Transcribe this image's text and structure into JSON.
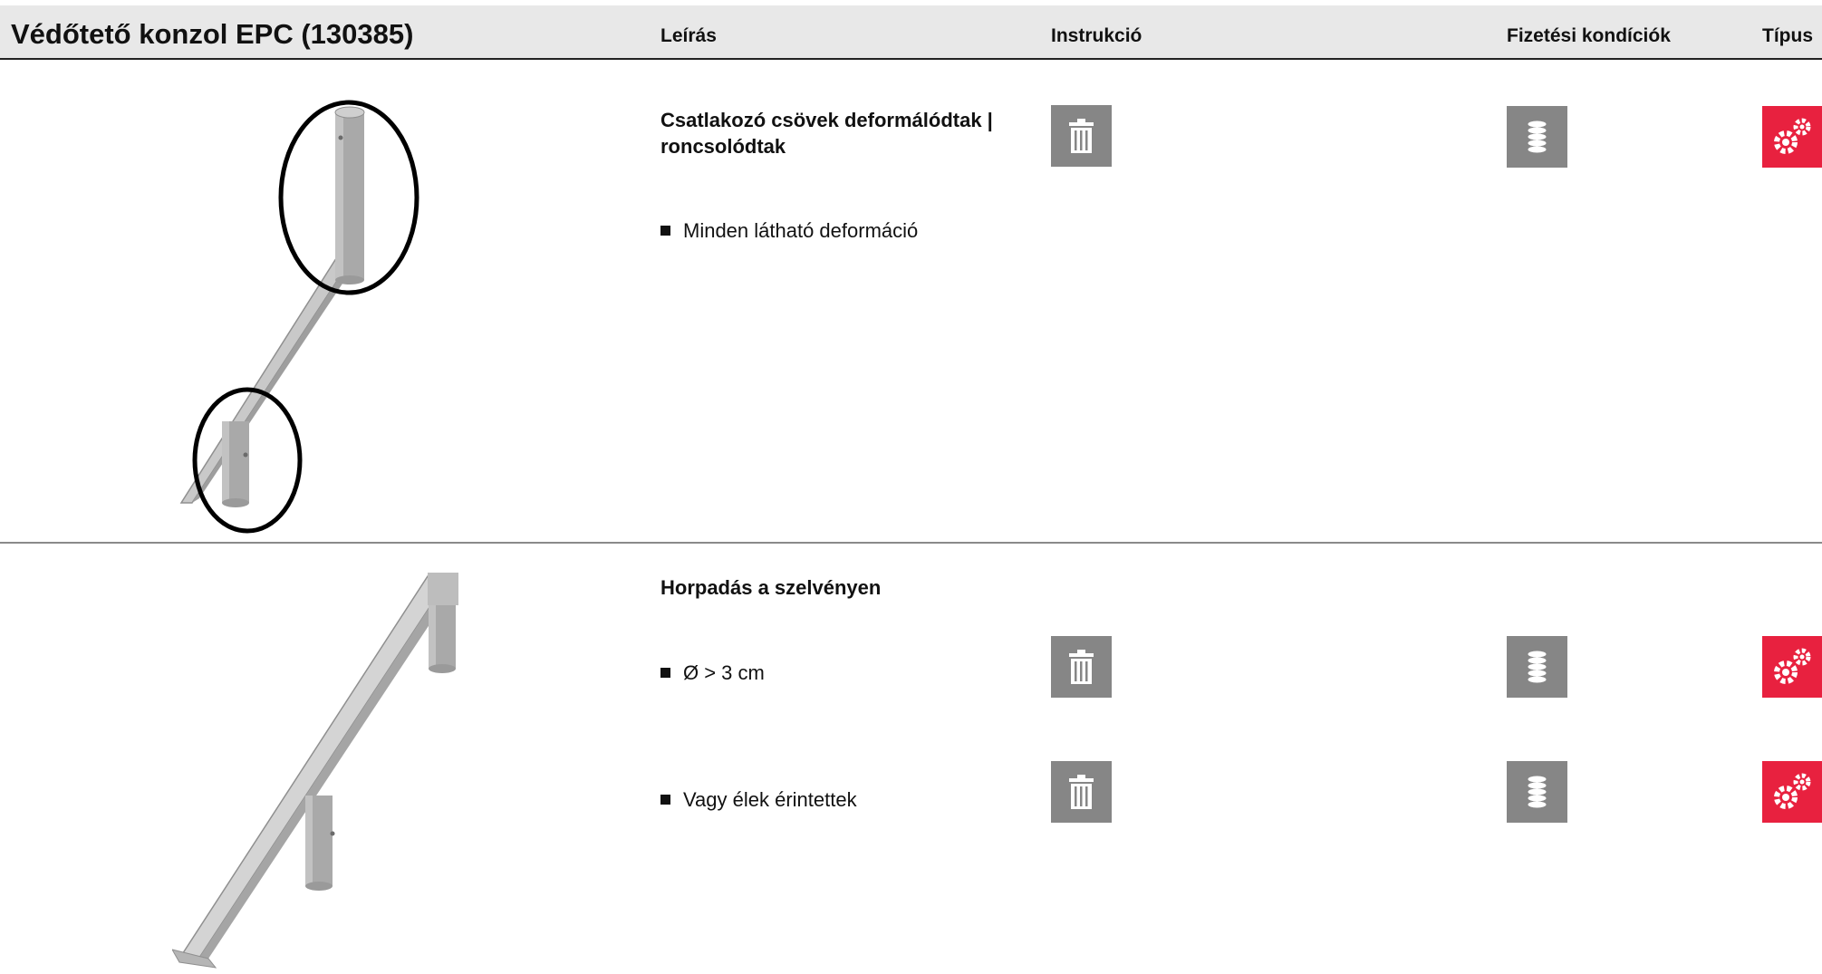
{
  "header": {
    "title": "Védőtető konzol EPC (130385)",
    "columns": {
      "description": "Leírás",
      "instruction": "Instrukció",
      "payment": "Fizetési kondíciók",
      "type": "Típus"
    }
  },
  "sections": [
    {
      "heading": "Csatlakozó csövek deformálódtak |",
      "heading_line2": "roncsolódtak",
      "bullets": [
        "Minden látható deformáció"
      ],
      "icons": [
        "trash-icon",
        "coins-icon",
        "gears-icon"
      ]
    },
    {
      "heading": "Horpadás a szelvényen",
      "bullets": [
        "Ø > 3 cm",
        "Vagy élek érintettek"
      ],
      "icons": [
        "trash-icon",
        "coins-icon",
        "gears-icon"
      ]
    }
  ],
  "colors": {
    "header_bg": "#e8e8e8",
    "instruction_icon_bg": "#868686",
    "type_icon_bg": "#e8213f"
  }
}
